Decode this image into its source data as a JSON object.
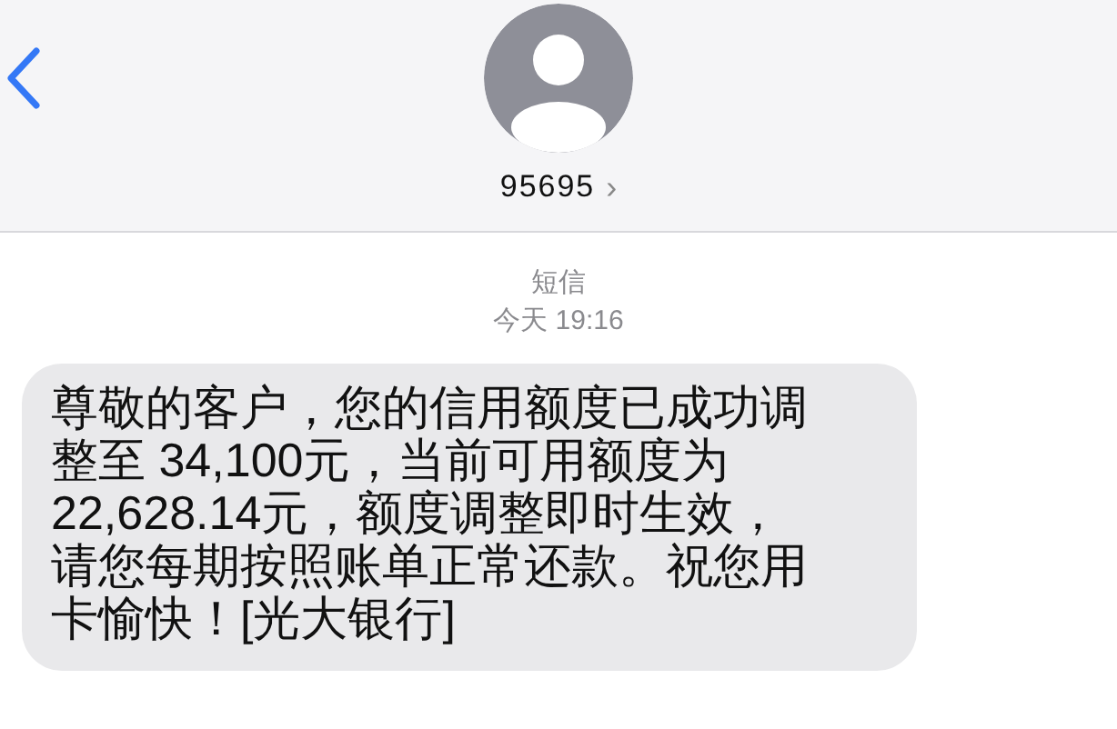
{
  "header": {
    "contact": "95695",
    "disclosure": "›"
  },
  "thread": {
    "service": "短信",
    "timestamp": "今天 19:16"
  },
  "messages": [
    {
      "lines": [
        "尊敬的客户，您的信用额度已成功调",
        "整至 34,100元，当前可用额度为",
        "22,628.14元，额度调整即时生效，",
        "请您每期按照账单正常还款。祝您用",
        "卡愉快！[光大银行]"
      ]
    }
  ]
}
